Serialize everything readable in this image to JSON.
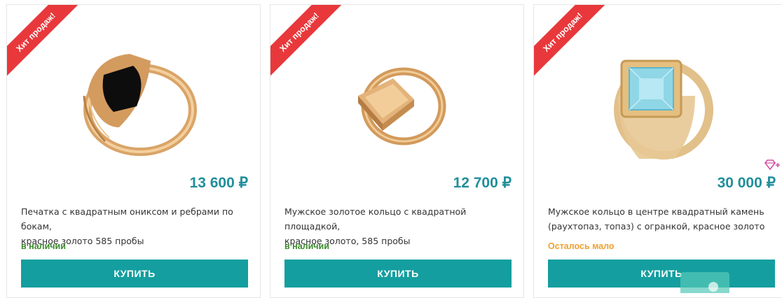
{
  "products": [
    {
      "badge": "Хит продаж!",
      "image": "onyx-signet-ring",
      "price": "13 600 ₽",
      "name_line1": "Печатка с квадратным ониксом и ребрами по бокам,",
      "name_line2": "красное золото 585 пробы",
      "stock": "в наличии",
      "stock_color": "#3a8a2a",
      "buy_label": "КУПИТЬ"
    },
    {
      "badge": "Хит продаж!",
      "image": "gold-square-signet-ring",
      "price": "12 700 ₽",
      "name_line1": "Мужское золотое кольцо с квадратной площадкой,",
      "name_line2": "красное золото, 585 пробы",
      "stock": "в наличии",
      "stock_color": "#3a8a2a",
      "buy_label": "КУПИТЬ"
    },
    {
      "badge": "Хит продаж!",
      "image": "topaz-ring",
      "price": "30 000 ₽",
      "name_line1": "Мужское кольцо в центре квадратный камень",
      "name_line2": "(раухтопаз, топаз) с огранкой, красное золото",
      "stock": "Осталось мало",
      "stock_color": "#f0a030",
      "buy_label": "КУПИТЬ",
      "extra_icon": "gem-plus-icon"
    }
  ],
  "colors": {
    "accent": "#149e9f",
    "price": "#218f9b",
    "badge": "#e8383b"
  }
}
